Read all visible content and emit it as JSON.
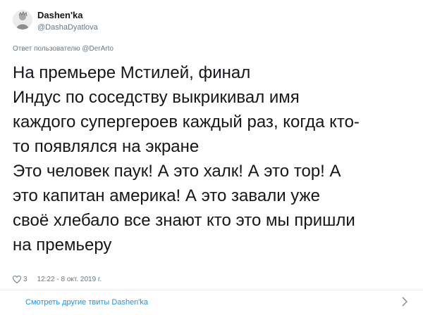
{
  "user": {
    "name": "Dashen'ka",
    "handle": "@DashaDyatlova"
  },
  "reply": {
    "prefix": "Ответ пользователю",
    "mention": "@DerArto"
  },
  "tweet": {
    "lines": [
      "На премьере Мстилей, финал",
      "Индус по соседству выкрикивал имя",
      "каждого супергероев каждый раз, когда кто-",
      "то появлялся на экране",
      "Это человек паук! А это халк! А это тор! А",
      "это капитан америка! А это завали уже",
      "своё хлебало все знают кто это мы пришли",
      "на премьеру"
    ]
  },
  "meta": {
    "likes": "3",
    "timestamp": "12:22 - 8 окт. 2019 г."
  },
  "footer": {
    "more_link": "Смотреть другие твиты Dashen'ka"
  },
  "icons": {
    "heart": "heart-icon",
    "chevron": "chevron-right-icon"
  },
  "colors": {
    "link": "#1b95e0",
    "secondary_text": "#657786",
    "primary_text": "#14171a"
  }
}
